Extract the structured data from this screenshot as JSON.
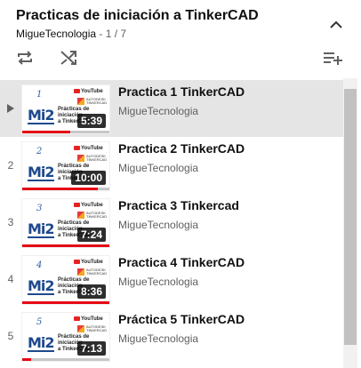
{
  "playlist": {
    "title": "Practicas de iniciación a TinkerCAD",
    "owner": "MigueTecnologia",
    "position": " - 1 / 7"
  },
  "icons": {
    "collapse": "chevron-up-icon",
    "loop": "loop-icon",
    "shuffle": "shuffle-icon",
    "save": "playlist-add-icon",
    "now_playing": "play-arrow-icon"
  },
  "colors": {
    "progress": "#e50914",
    "active_row": "#e5e5e5"
  },
  "items": [
    {
      "index": "",
      "thumb_number": "1",
      "title": "Practica 1 TinkerCAD",
      "channel": "MigueTecnologia",
      "duration": "5:39",
      "progress": 0.55,
      "active": true
    },
    {
      "index": "2",
      "thumb_number": "2",
      "title": "Practica 2 TinkerCAD",
      "channel": "MigueTecnologia",
      "duration": "10:00",
      "progress": 0.87
    },
    {
      "index": "3",
      "thumb_number": "3",
      "title": "Practica 3 Tinkercad",
      "channel": "MigueTecnologia",
      "duration": "7:24",
      "progress": 1.0
    },
    {
      "index": "4",
      "thumb_number": "4",
      "title": "Practica 4 TinkerCAD",
      "channel": "MigueTecnologia",
      "duration": "8:36",
      "progress": 1.0
    },
    {
      "index": "5",
      "thumb_number": "5",
      "title": "Práctica 5 TinkerCAD",
      "channel": "MigueTecnologia",
      "duration": "7:13",
      "progress": 0.1
    }
  ]
}
